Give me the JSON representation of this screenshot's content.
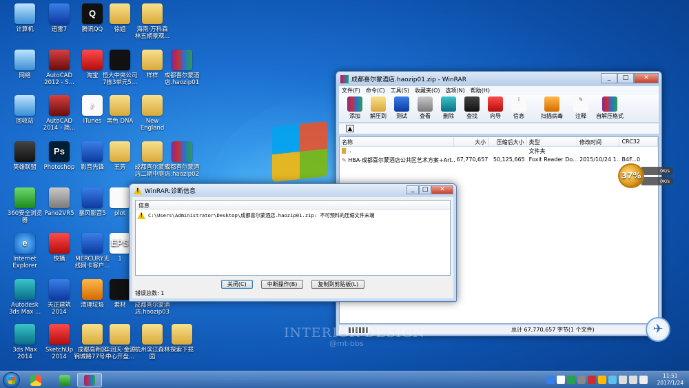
{
  "desktop": {
    "icons": [
      {
        "label": "计算机",
        "icon": "computer-icon"
      },
      {
        "label": "迅雷7",
        "icon": "thunder-icon"
      },
      {
        "label": "腾讯QQ",
        "icon": "qq-icon"
      },
      {
        "label": "徐姐",
        "icon": "folder-icon"
      },
      {
        "label": "海南·万科森\n林五期景观...",
        "icon": "folder-icon"
      },
      {
        "label": "网络",
        "icon": "network-icon"
      },
      {
        "label": "AutoCAD\n2012 - S...",
        "icon": "autocad-icon"
      },
      {
        "label": "淘宝",
        "icon": "taobao-icon"
      },
      {
        "label": "恒大中央公司\n7栋3单元5...",
        "icon": "image-file-icon"
      },
      {
        "label": "样样",
        "icon": "folder-icon"
      },
      {
        "label": "成都喜尔蒙酒\n店.haozip01",
        "icon": "winrar-archive-icon"
      },
      {
        "label": "回收站",
        "icon": "recycle-bin-icon"
      },
      {
        "label": "AutoCAD\n2014 - 简...",
        "icon": "autocad-icon"
      },
      {
        "label": "iTunes",
        "icon": "itunes-icon"
      },
      {
        "label": "黑色 DNA",
        "icon": "folder-icon"
      },
      {
        "label": "New\nEngland",
        "icon": "folder-icon"
      },
      {
        "label": "英雄联盟",
        "icon": "lol-icon"
      },
      {
        "label": "Photoshop",
        "icon": "photoshop-icon"
      },
      {
        "label": "影音先锋",
        "icon": "media-player-icon"
      },
      {
        "label": "王芳",
        "icon": "folder-icon"
      },
      {
        "label": "成都喜尔蒙酒\n店二期中庭...",
        "icon": "folder-icon"
      },
      {
        "label": "成都喜尔蒙酒\n店.haozip02",
        "icon": "winrar-archive-icon"
      },
      {
        "label": "360安全浏览\n器",
        "icon": "browser-360-icon"
      },
      {
        "label": "Pano2VR5",
        "icon": "pano2vr-icon"
      },
      {
        "label": "暴风影音5",
        "icon": "baofeng-icon"
      },
      {
        "label": "plot",
        "icon": "text-file-icon"
      },
      {
        "label": "Internet\nExplorer",
        "icon": "ie-icon"
      },
      {
        "label": "快播",
        "icon": "kuaibo-icon"
      },
      {
        "label": "MERCURY无\n线网卡客户...",
        "icon": "signal-icon"
      },
      {
        "label": "1",
        "icon": "eps-file-icon"
      },
      {
        "label": "Autodesk\n3ds Max ...",
        "icon": "3dsmax-icon"
      },
      {
        "label": "天正建筑\n2014",
        "icon": "tangent-icon"
      },
      {
        "label": "清理垃圾",
        "icon": "cleanup-icon"
      },
      {
        "label": "素材",
        "icon": "image-file-icon"
      },
      {
        "label": "成都喜尔蒙酒\n店.haozip03",
        "icon": "winrar-archive-icon"
      },
      {
        "label": "3ds Max\n2014",
        "icon": "3dsmax-icon"
      },
      {
        "label": "SketchUp\n2014",
        "icon": "sketchup-icon"
      },
      {
        "label": "成都高新区\n锦城路77号...",
        "icon": "folder-icon"
      },
      {
        "label": "华润天·金源\n中心开盘...",
        "icon": "folder-icon"
      },
      {
        "label": "杭州滨江森林\n园",
        "icon": "folder-icon"
      },
      {
        "label": "探索下载",
        "icon": "folder-icon"
      }
    ]
  },
  "winrar": {
    "title": "成都喜尔蒙酒店.haozip01.zip - WinRAR",
    "menu": [
      "文件(F)",
      "命令(C)",
      "工具(S)",
      "收藏夹(O)",
      "选项(N)",
      "帮助(H)"
    ],
    "toolbar": [
      "添加",
      "解压到",
      "测试",
      "查看",
      "删除",
      "查找",
      "向导",
      "信息",
      "扫描病毒",
      "注释",
      "自解压格式"
    ],
    "columns": [
      "名称",
      "大小",
      "压缩后大小",
      "类型",
      "修改时间",
      "CRC32"
    ],
    "rows": [
      {
        "name": "..",
        "size": "",
        "packed": "",
        "type": "文件夹",
        "modified": "",
        "crc": ""
      },
      {
        "name": "HBA-成都喜尔蒙酒店公共区艺术方案+Art...",
        "size": "67,770,657",
        "packed": "50,125,665",
        "type": "Foxit Reader Do...",
        "modified": "2015/10/24 1...",
        "crc": "B4F...0"
      }
    ],
    "status": "总计 67,770,657 字节(1 个文件)"
  },
  "dialog": {
    "title": "WinRAR:诊断信息",
    "column": "信息",
    "message": "C:\\Users\\Administrator\\Desktop\\成都喜尔蒙酒店.haozip01.zip: 不可预料的压缩文件末端",
    "buttons": [
      "关闭(C)",
      "中断操作(B)",
      "复制到剪贴板(L)"
    ],
    "footer": "错误总数: 1"
  },
  "speed_widget": {
    "percent": "37%",
    "up": "0K/s",
    "down": "0K/s"
  },
  "watermark": {
    "line1": "INTERIOR DESIGN",
    "line2": "@mt-bbs"
  },
  "taskbar": {
    "time": "11:51",
    "date": "2017/1/24"
  },
  "colors": {
    "accent": "#1b6fd0",
    "warning": "#f2c200"
  }
}
